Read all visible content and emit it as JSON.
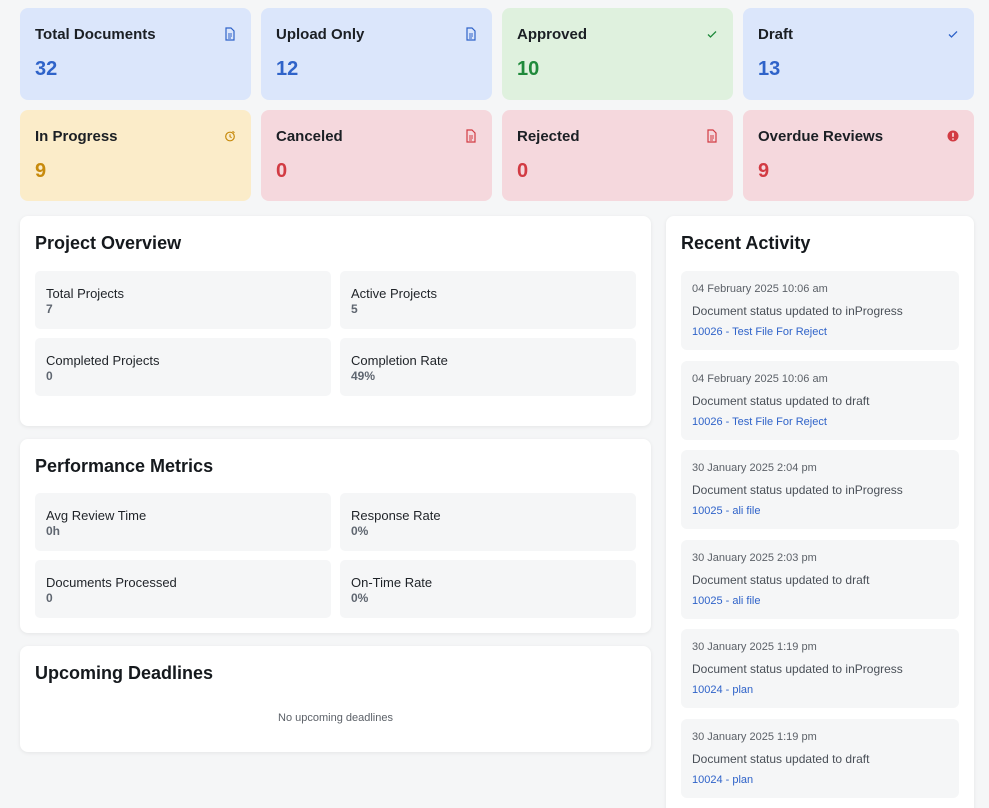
{
  "stats": [
    {
      "label": "Total Documents",
      "value": "32",
      "icon": "document-icon"
    },
    {
      "label": "Upload Only",
      "value": "12",
      "icon": "document-icon"
    },
    {
      "label": "Approved",
      "value": "10",
      "icon": "check-icon"
    },
    {
      "label": "Draft",
      "value": "13",
      "icon": "check-icon"
    },
    {
      "label": "In Progress",
      "value": "9",
      "icon": "clock-icon"
    },
    {
      "label": "Canceled",
      "value": "0",
      "icon": "document-icon"
    },
    {
      "label": "Rejected",
      "value": "0",
      "icon": "document-icon"
    },
    {
      "label": "Overdue Reviews",
      "value": "9",
      "icon": "alert-icon"
    }
  ],
  "colors": {
    "blue": "#2f63c9",
    "green": "#1f8a3b",
    "yellow": "#c78a0c",
    "red": "#d23b43"
  },
  "project_overview": {
    "title": "Project Overview",
    "items": [
      {
        "label": "Total Projects",
        "value": "7"
      },
      {
        "label": "Active Projects",
        "value": "5"
      },
      {
        "label": "Completed Projects",
        "value": "0"
      },
      {
        "label": "Completion Rate",
        "value": "49%"
      }
    ]
  },
  "performance": {
    "title": "Performance Metrics",
    "items": [
      {
        "label": "Avg Review Time",
        "value": "0h"
      },
      {
        "label": "Response Rate",
        "value": "0%"
      },
      {
        "label": "Documents Processed",
        "value": "0"
      },
      {
        "label": "On-Time Rate",
        "value": "0%"
      }
    ]
  },
  "deadlines": {
    "title": "Upcoming Deadlines",
    "empty": "No upcoming deadlines"
  },
  "activity": {
    "title": "Recent Activity",
    "items": [
      {
        "date": "04 February 2025 10:06 am",
        "message": "Document status updated to inProgress",
        "link": "10026 - Test File For Reject"
      },
      {
        "date": "04 February 2025 10:06 am",
        "message": "Document status updated to draft",
        "link": "10026 - Test File For Reject"
      },
      {
        "date": "30 January 2025 2:04 pm",
        "message": "Document status updated to inProgress",
        "link": "10025 - ali file"
      },
      {
        "date": "30 January 2025 2:03 pm",
        "message": "Document status updated to draft",
        "link": "10025 - ali file"
      },
      {
        "date": "30 January 2025 1:19 pm",
        "message": "Document status updated to inProgress",
        "link": "10024 - plan"
      },
      {
        "date": "30 January 2025 1:19 pm",
        "message": "Document status updated to draft",
        "link": "10024 - plan"
      }
    ]
  }
}
